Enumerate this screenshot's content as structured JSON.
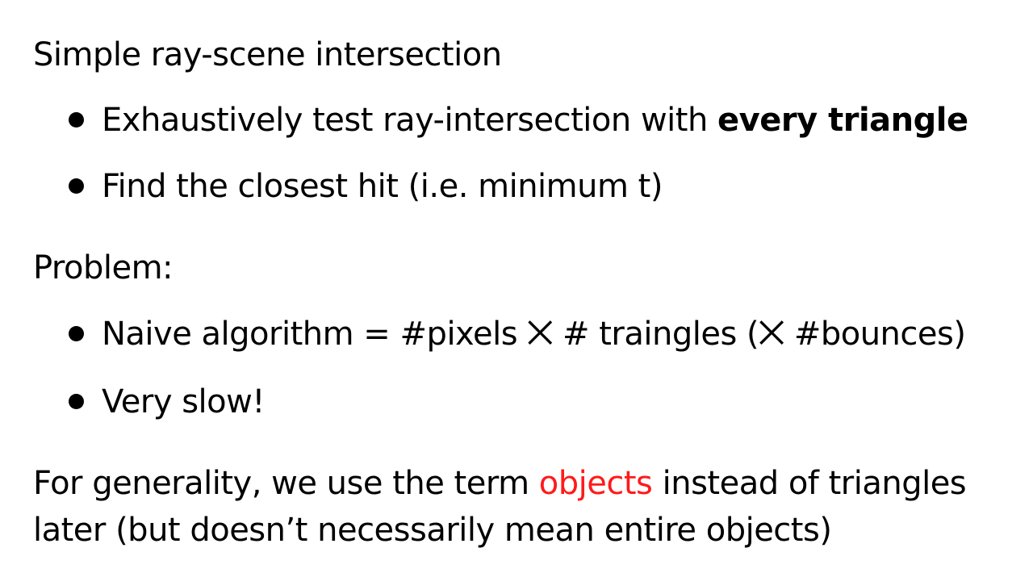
{
  "heading": "Simple ray-scene intersection",
  "bullets_a": [
    {
      "text": "Exhaustively test ray-intersection with ",
      "bold": "every triangle"
    },
    {
      "text": "Find the closest hit (i.e. minimum t)"
    }
  ],
  "problem_label": "Problem:",
  "bullets_b": [
    {
      "text": "Naive algorithm = #pixels ⨉ # traingles (⨉ #bounces)"
    },
    {
      "text": "Very slow!"
    }
  ],
  "note": {
    "pre": "For generality, we use the term ",
    "highlight": "objects",
    "post": " instead of triangles",
    "line2": "later (but doesn’t necessarily mean entire objects)"
  },
  "colors": {
    "highlight": "#ff1a1a",
    "text": "#000000",
    "background": "#ffffff"
  }
}
